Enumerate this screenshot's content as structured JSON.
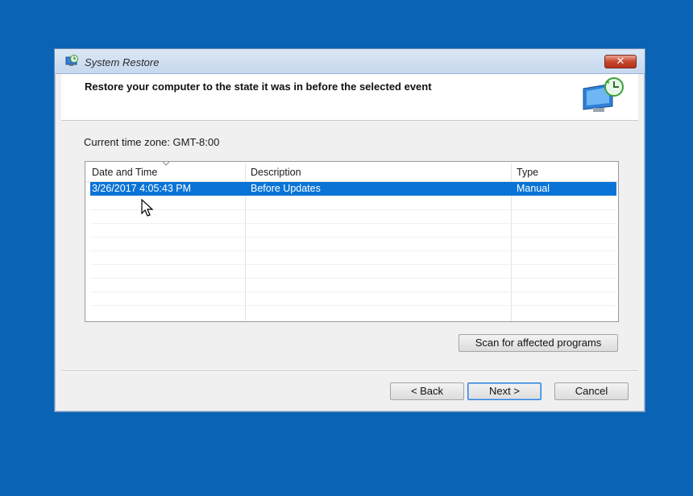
{
  "window": {
    "title": "System Restore",
    "close_label": "✕"
  },
  "header": {
    "title": "Restore your computer to the state it was in before the selected event",
    "icon": "system-restore-monitor-icon"
  },
  "timezone_label": "Current time zone: GMT-8:00",
  "list": {
    "columns": [
      "Date and Time",
      "Description",
      "Type"
    ],
    "rows": [
      {
        "date": "3/26/2017 4:05:43 PM",
        "description": "Before Updates",
        "type": "Manual",
        "selected": true
      }
    ]
  },
  "buttons": {
    "scan": "Scan for affected programs",
    "back": "< Back",
    "next": "Next >",
    "cancel": "Cancel"
  },
  "colors": {
    "desktop": "#0a63b5",
    "selection": "#0a74d6"
  }
}
